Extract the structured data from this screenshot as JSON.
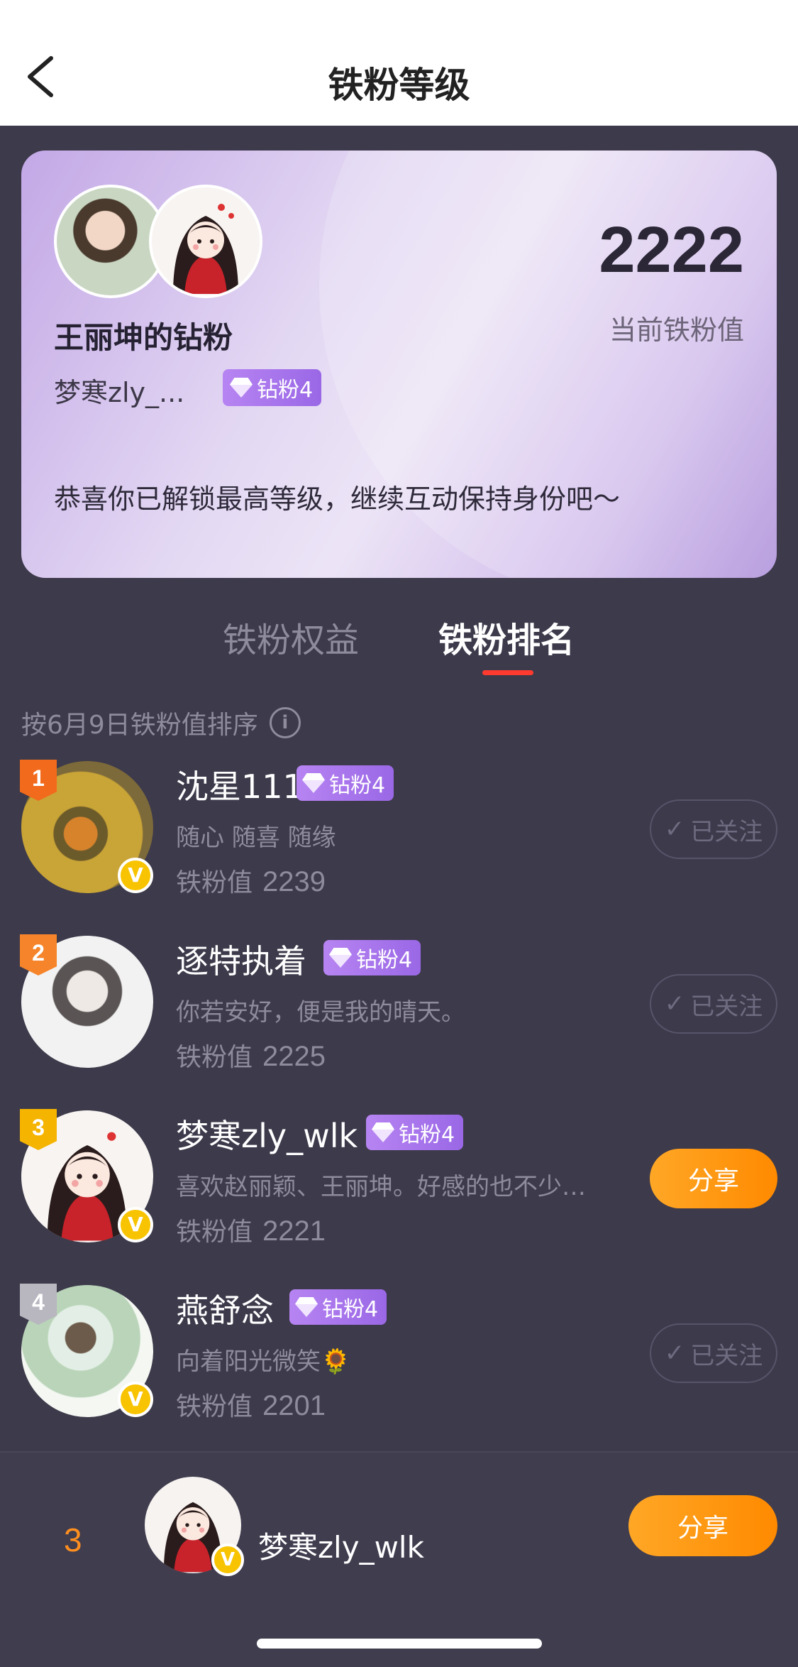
{
  "header": {
    "title": "铁粉等级",
    "back_icon": "chevron-left-icon"
  },
  "card": {
    "group_name": "王丽坤的钻粉",
    "username": "梦寒zly_...",
    "badge": "钻粉4",
    "score": "2222",
    "score_label": "当前铁粉值",
    "message": "恭喜你已解锁最高等级，继续互动保持身份吧～"
  },
  "tabs": [
    {
      "label": "铁粉权益",
      "active": false
    },
    {
      "label": "铁粉排名",
      "active": true
    }
  ],
  "sort_note": "按6月9日铁粉值排序",
  "score_prefix": "铁粉值",
  "colors": {
    "rank1": "#f26a1b",
    "rank2": "#f5842a",
    "rank3": "#f5b400",
    "rank4": "#b8b6bf",
    "accent": "#ff8a00",
    "tab_indicator": "#ff3b30"
  },
  "ranking": [
    {
      "rank": "1",
      "name": "沈星111",
      "badge": "钻粉4",
      "bio": "随心 随喜 随缘",
      "score": "2239",
      "action": "已关注",
      "verified": true
    },
    {
      "rank": "2",
      "name": "逐特执着",
      "badge": "钻粉4",
      "bio": "你若安好，便是我的晴天。",
      "score": "2225",
      "action": "已关注",
      "verified": false
    },
    {
      "rank": "3",
      "name": "梦寒zly_wlk",
      "badge": "钻粉4",
      "bio": "喜欢赵丽颖、王丽坤。好感的也不少…",
      "score": "2221",
      "action": "分享",
      "verified": true
    },
    {
      "rank": "4",
      "name": "燕舒念",
      "badge": "钻粉4",
      "bio": "向着阳光微笑🌻",
      "score": "2201",
      "action": "已关注",
      "verified": true
    }
  ],
  "bottom_bar": {
    "rank": "3",
    "name": "梦寒zly_wlk",
    "action": "分享"
  }
}
